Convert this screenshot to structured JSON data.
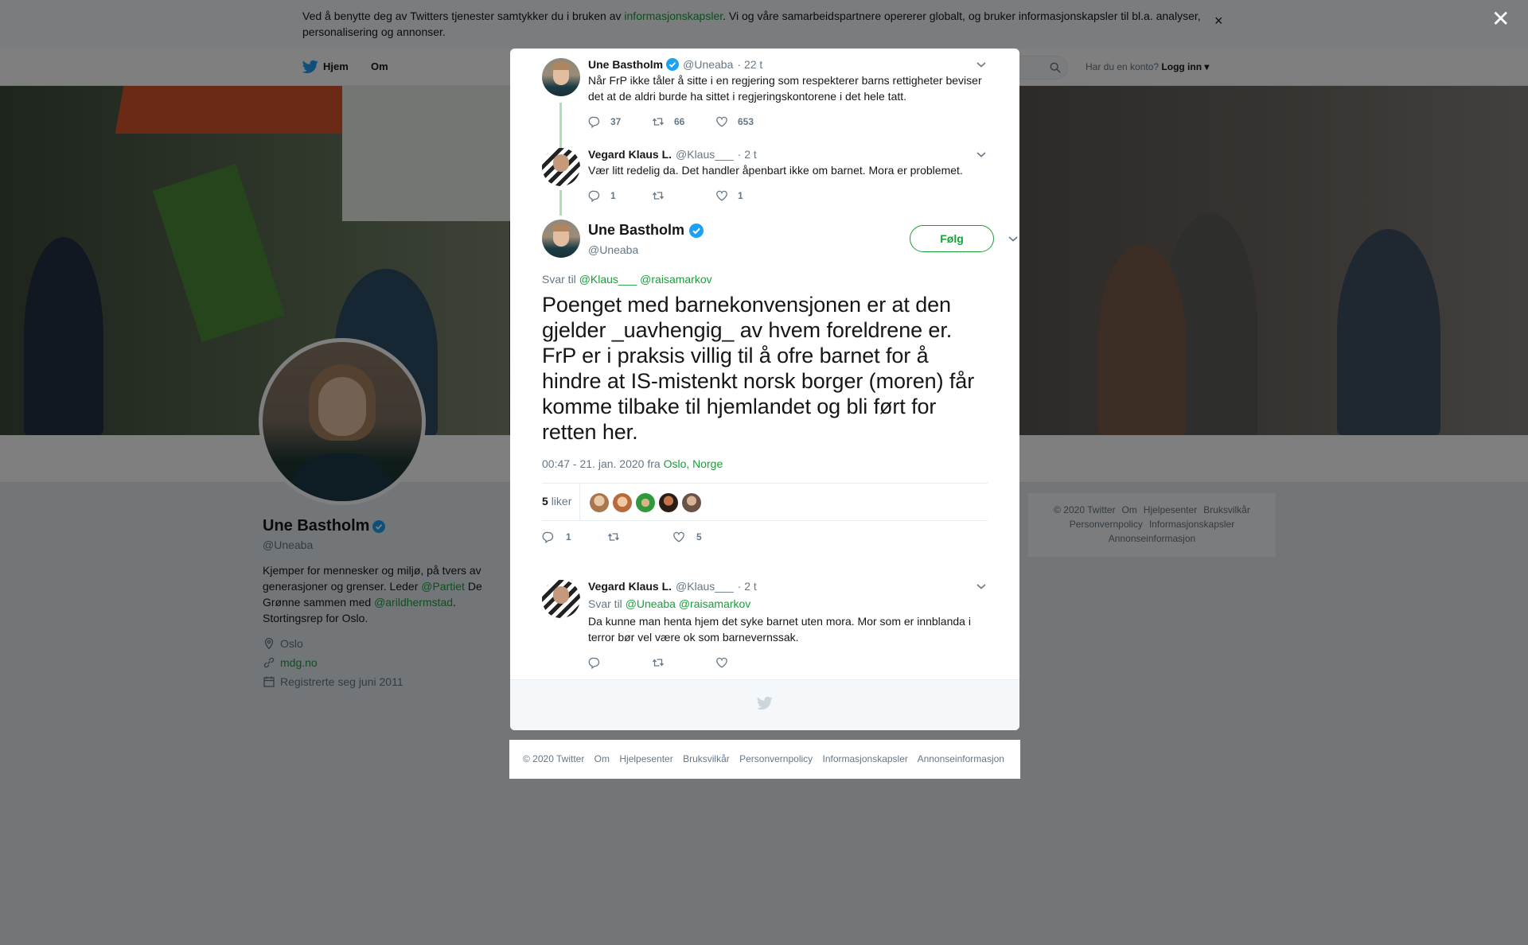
{
  "cookie_banner": {
    "text_before": "Ved å benytte deg av Twitters tjenester samtykker du i bruken av ",
    "link": "informasjonskapsler",
    "text_after": ". Vi og våre samarbeidspartnere opererer globalt, og bruker informasjonskapsler til bl.a. analyser, personalisering og annonser.",
    "close": "×"
  },
  "topnav": {
    "home": "Hjem",
    "about": "Om",
    "account_question": "Har du en konto?",
    "login": "Logg inn"
  },
  "overlay_close": "✕",
  "profile": {
    "name": "Une Bastholm",
    "handle": "@Uneaba",
    "bio_1": "Kjemper for mennesker og miljø, på tvers av generasjoner og grenser. Leder ",
    "bio_link_1": "@Partiet",
    "bio_2": " De Grønne sammen med ",
    "bio_link_2": "@arildhermstad",
    "bio_3": ". Stortingsrep for Oslo.",
    "location": "Oslo",
    "website": "mdg.no",
    "joined": "Registrerte seg juni 2011"
  },
  "side_footer": [
    "© 2020 Twitter",
    "Om",
    "Hjelpesenter",
    "Bruksvilkår",
    "Personvernpolicy",
    "Informasjonskapsler",
    "Annonseinformasjon"
  ],
  "thread": {
    "tweet1": {
      "name": "Une Bastholm",
      "handle": "@Uneaba",
      "time": "· 22 t",
      "text": "Når FrP ikke tåler å sitte i en regjering som respekterer barns rettigheter beviser det at de aldri burde ha sittet i regjeringskontorene i det hele tatt.",
      "replies": "37",
      "retweets": "66",
      "likes": "653"
    },
    "tweet2": {
      "name": "Vegard Klaus L.",
      "handle": "@Klaus___",
      "time": "· 2 t",
      "text": "Vær litt redelig da. Det handler åpenbart ikke om barnet. Mora er problemet.",
      "replies": "1",
      "retweets": "",
      "likes": "1"
    },
    "main": {
      "name": "Une Bastholm",
      "handle": "@Uneaba",
      "follow": "Følg",
      "reply_to_label": "Svar til ",
      "reply_to_1": "@Klaus___",
      "reply_to_2": "@raisamarkov",
      "text": "Poenget med barnekonvensjonen er at den gjelder _uavhengig_ av hvem foreldrene er. FrP er i praksis villig til å ofre barnet for å hindre at IS-mistenkt norsk borger (moren) får komme tilbake til hjemlandet og bli ført for retten her.",
      "timestamp": "00:47 - 21. jan. 2020 fra ",
      "location": "Oslo, Norge",
      "likes_count": "5",
      "likes_label": "liker",
      "replies": "1",
      "retweets": "",
      "likes": "5"
    },
    "reply": {
      "name": "Vegard Klaus L.",
      "handle": "@Klaus___",
      "time": "· 2 t",
      "reply_to_label": "Svar til ",
      "reply_to_1": "@Uneaba",
      "reply_to_2": "@raisamarkov",
      "text": "Da kunne man henta hjem det syke barnet uten mora. Mor som er innblanda i terror bør vel være ok som barnevernssak."
    }
  },
  "modal_footer": [
    "© 2020 Twitter",
    "Om",
    "Hjelpesenter",
    "Bruksvilkår",
    "Personvernpolicy",
    "Informasjonskapsler",
    "Annonseinformasjon"
  ],
  "colors": {
    "accent": "#17a03a",
    "verified": "#1da1f2",
    "muted": "#657786"
  }
}
